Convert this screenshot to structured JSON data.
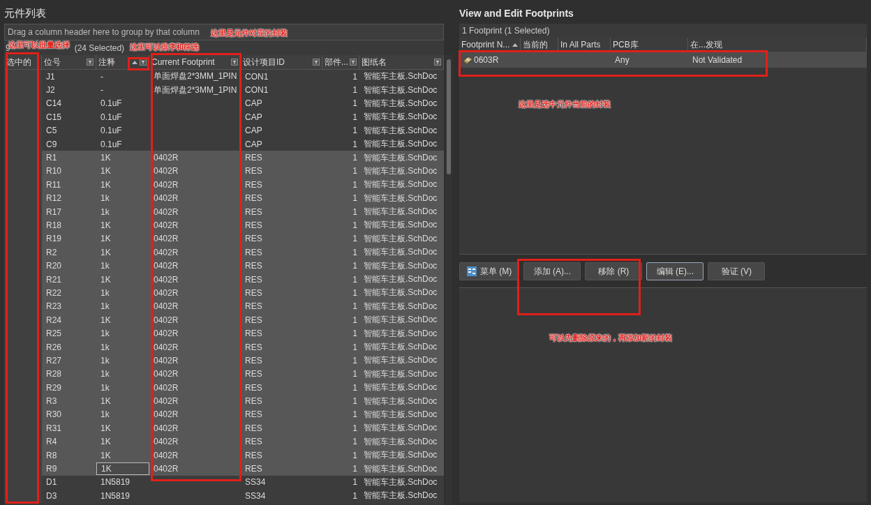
{
  "left_panel": {
    "title": "元件列表",
    "group_hint": "Drag a column header here to group by that column",
    "summary": [
      "9",
      "(24 Selected)"
    ],
    "columns": [
      {
        "label": "选中的",
        "filter": false,
        "sort": false
      },
      {
        "label": "位号",
        "filter": true,
        "sort": false
      },
      {
        "label": "注释",
        "filter": true,
        "sort": true
      },
      {
        "label": "Current Footprint",
        "filter": true,
        "sort": false
      },
      {
        "label": "设计项目ID",
        "filter": true,
        "sort": false
      },
      {
        "label": "部件...",
        "filter": true,
        "sort": false
      },
      {
        "label": "图纸名",
        "filter": true,
        "sort": false
      }
    ],
    "rows": [
      {
        "designator": "J1",
        "comment": "-",
        "footprint": "单面焊盘2*3MM_1PIN",
        "design_item_id": "CON1",
        "part": "1",
        "sheet": "智能车主板.SchDoc",
        "selected": false,
        "editing": false
      },
      {
        "designator": "J2",
        "comment": "-",
        "footprint": "单面焊盘2*3MM_1PIN",
        "design_item_id": "CON1",
        "part": "1",
        "sheet": "智能车主板.SchDoc",
        "selected": false,
        "editing": false
      },
      {
        "designator": "C14",
        "comment": "0.1uF",
        "footprint": "",
        "design_item_id": "CAP",
        "part": "1",
        "sheet": "智能车主板.SchDoc",
        "selected": false,
        "editing": false
      },
      {
        "designator": "C15",
        "comment": "0.1uF",
        "footprint": "",
        "design_item_id": "CAP",
        "part": "1",
        "sheet": "智能车主板.SchDoc",
        "selected": false,
        "editing": false
      },
      {
        "designator": "C5",
        "comment": "0.1uF",
        "footprint": "",
        "design_item_id": "CAP",
        "part": "1",
        "sheet": "智能车主板.SchDoc",
        "selected": false,
        "editing": false
      },
      {
        "designator": "C9",
        "comment": "0.1uF",
        "footprint": "",
        "design_item_id": "CAP",
        "part": "1",
        "sheet": "智能车主板.SchDoc",
        "selected": false,
        "editing": false
      },
      {
        "designator": "R1",
        "comment": "1K",
        "footprint": "0402R",
        "design_item_id": "RES",
        "part": "1",
        "sheet": "智能车主板.SchDoc",
        "selected": true,
        "editing": false
      },
      {
        "designator": "R10",
        "comment": "1K",
        "footprint": "0402R",
        "design_item_id": "RES",
        "part": "1",
        "sheet": "智能车主板.SchDoc",
        "selected": true,
        "editing": false
      },
      {
        "designator": "R11",
        "comment": "1K",
        "footprint": "0402R",
        "design_item_id": "RES",
        "part": "1",
        "sheet": "智能车主板.SchDoc",
        "selected": true,
        "editing": false
      },
      {
        "designator": "R12",
        "comment": "1k",
        "footprint": "0402R",
        "design_item_id": "RES",
        "part": "1",
        "sheet": "智能车主板.SchDoc",
        "selected": true,
        "editing": false
      },
      {
        "designator": "R17",
        "comment": "1k",
        "footprint": "0402R",
        "design_item_id": "RES",
        "part": "1",
        "sheet": "智能车主板.SchDoc",
        "selected": true,
        "editing": false
      },
      {
        "designator": "R18",
        "comment": "1K",
        "footprint": "0402R",
        "design_item_id": "RES",
        "part": "1",
        "sheet": "智能车主板.SchDoc",
        "selected": true,
        "editing": false
      },
      {
        "designator": "R19",
        "comment": "1K",
        "footprint": "0402R",
        "design_item_id": "RES",
        "part": "1",
        "sheet": "智能车主板.SchDoc",
        "selected": true,
        "editing": false
      },
      {
        "designator": "R2",
        "comment": "1K",
        "footprint": "0402R",
        "design_item_id": "RES",
        "part": "1",
        "sheet": "智能车主板.SchDoc",
        "selected": true,
        "editing": false
      },
      {
        "designator": "R20",
        "comment": "1k",
        "footprint": "0402R",
        "design_item_id": "RES",
        "part": "1",
        "sheet": "智能车主板.SchDoc",
        "selected": true,
        "editing": false
      },
      {
        "designator": "R21",
        "comment": "1K",
        "footprint": "0402R",
        "design_item_id": "RES",
        "part": "1",
        "sheet": "智能车主板.SchDoc",
        "selected": true,
        "editing": false
      },
      {
        "designator": "R22",
        "comment": "1k",
        "footprint": "0402R",
        "design_item_id": "RES",
        "part": "1",
        "sheet": "智能车主板.SchDoc",
        "selected": true,
        "editing": false
      },
      {
        "designator": "R23",
        "comment": "1k",
        "footprint": "0402R",
        "design_item_id": "RES",
        "part": "1",
        "sheet": "智能车主板.SchDoc",
        "selected": true,
        "editing": false
      },
      {
        "designator": "R24",
        "comment": "1K",
        "footprint": "0402R",
        "design_item_id": "RES",
        "part": "1",
        "sheet": "智能车主板.SchDoc",
        "selected": true,
        "editing": false
      },
      {
        "designator": "R25",
        "comment": "1k",
        "footprint": "0402R",
        "design_item_id": "RES",
        "part": "1",
        "sheet": "智能车主板.SchDoc",
        "selected": true,
        "editing": false
      },
      {
        "designator": "R26",
        "comment": "1k",
        "footprint": "0402R",
        "design_item_id": "RES",
        "part": "1",
        "sheet": "智能车主板.SchDoc",
        "selected": true,
        "editing": false
      },
      {
        "designator": "R27",
        "comment": "1k",
        "footprint": "0402R",
        "design_item_id": "RES",
        "part": "1",
        "sheet": "智能车主板.SchDoc",
        "selected": true,
        "editing": false
      },
      {
        "designator": "R28",
        "comment": "1k",
        "footprint": "0402R",
        "design_item_id": "RES",
        "part": "1",
        "sheet": "智能车主板.SchDoc",
        "selected": true,
        "editing": false
      },
      {
        "designator": "R29",
        "comment": "1k",
        "footprint": "0402R",
        "design_item_id": "RES",
        "part": "1",
        "sheet": "智能车主板.SchDoc",
        "selected": true,
        "editing": false
      },
      {
        "designator": "R3",
        "comment": "1K",
        "footprint": "0402R",
        "design_item_id": "RES",
        "part": "1",
        "sheet": "智能车主板.SchDoc",
        "selected": true,
        "editing": false
      },
      {
        "designator": "R30",
        "comment": "1k",
        "footprint": "0402R",
        "design_item_id": "RES",
        "part": "1",
        "sheet": "智能车主板.SchDoc",
        "selected": true,
        "editing": false
      },
      {
        "designator": "R31",
        "comment": "1K",
        "footprint": "0402R",
        "design_item_id": "RES",
        "part": "1",
        "sheet": "智能车主板.SchDoc",
        "selected": true,
        "editing": false
      },
      {
        "designator": "R4",
        "comment": "1K",
        "footprint": "0402R",
        "design_item_id": "RES",
        "part": "1",
        "sheet": "智能车主板.SchDoc",
        "selected": true,
        "editing": false
      },
      {
        "designator": "R8",
        "comment": "1K",
        "footprint": "0402R",
        "design_item_id": "RES",
        "part": "1",
        "sheet": "智能车主板.SchDoc",
        "selected": true,
        "editing": false
      },
      {
        "designator": "R9",
        "comment": "1K",
        "footprint": "0402R",
        "design_item_id": "RES",
        "part": "1",
        "sheet": "智能车主板.SchDoc",
        "selected": true,
        "editing": true
      },
      {
        "designator": "D1",
        "comment": "1N5819",
        "footprint": "",
        "design_item_id": "SS34",
        "part": "1",
        "sheet": "智能车主板.SchDoc",
        "selected": false,
        "editing": false
      },
      {
        "designator": "D3",
        "comment": "1N5819",
        "footprint": "",
        "design_item_id": "SS34",
        "part": "1",
        "sheet": "智能车主板.SchDoc",
        "selected": false,
        "editing": false
      }
    ]
  },
  "right_panel": {
    "title": "View and Edit Footprints",
    "summary": "1 Footprint (1 Selected)",
    "columns": [
      {
        "label": "Footprint N...",
        "sort": true
      },
      {
        "label": "当前的",
        "sort": false
      },
      {
        "label": "In All Parts",
        "sort": false
      },
      {
        "label": "PCB库",
        "sort": false
      },
      {
        "label": "在...发现",
        "sort": false
      }
    ],
    "rows": [
      {
        "name": "0603R",
        "current": "",
        "in_all_parts": "",
        "pcb_library": "Any",
        "found_in": "Not Validated",
        "selected": true
      }
    ],
    "buttons": [
      {
        "label": "菜单 (M)",
        "kind": "menu",
        "focused": false
      },
      {
        "label": "添加 (A)...",
        "kind": "plain",
        "focused": false
      },
      {
        "label": "移除 (R)",
        "kind": "plain",
        "focused": false
      },
      {
        "label": "编辑 (E)...",
        "kind": "plain",
        "focused": true
      },
      {
        "label": "验证 (V)",
        "kind": "plain",
        "focused": false
      }
    ]
  },
  "annotations": [
    {
      "kind": "note",
      "text": "这里是元件对应的封装"
    },
    {
      "kind": "note",
      "text": "这里可以批量选择"
    },
    {
      "kind": "note",
      "text": "这里可以排序和筛选"
    },
    {
      "kind": "note",
      "text": "这里是选中元件当前的封装"
    },
    {
      "kind": "note",
      "text": "可以先删除原来的，再添加新的封装"
    },
    {
      "kind": "frame"
    },
    {
      "kind": "frame"
    },
    {
      "kind": "frame"
    },
    {
      "kind": "frame"
    },
    {
      "kind": "frame"
    }
  ]
}
